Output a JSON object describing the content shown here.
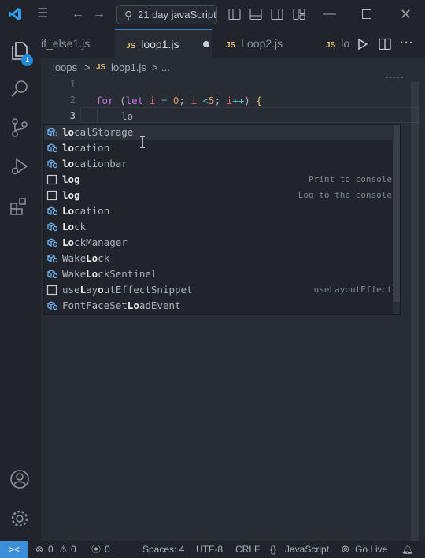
{
  "title_bar": {
    "search_text": "21 day javaScript"
  },
  "activity_bar": {
    "explorer_badge": "1"
  },
  "tabs": [
    {
      "label": "if_else1.js",
      "lang": ""
    },
    {
      "label": "loop1.js",
      "lang": "JS",
      "active": true,
      "modified": true
    },
    {
      "label": "Loop2.js",
      "lang": "JS"
    },
    {
      "label": "lo",
      "lang": "JS"
    }
  ],
  "breadcrumb": {
    "folder": "loops",
    "sep1": ">",
    "file_lang": "JS",
    "file": "loop1.js",
    "sep2": ">",
    "more": "..."
  },
  "editor": {
    "line_numbers": [
      "1",
      "2",
      "3"
    ],
    "line2": {
      "for": "for",
      "paren_open": " (",
      "let": "let",
      "i1": " i ",
      "eq": "=",
      "zero": " 0",
      "semi1": "; ",
      "i2": "i ",
      "lt": "<",
      "five": "5",
      "semi2": "; ",
      "i3": "i",
      "inc": "++",
      "close": ")",
      "brace": " {"
    },
    "line3_text": "lo"
  },
  "suggestions": [
    {
      "pre": "lo",
      "post": "calStorage",
      "kind": "property",
      "detail": ""
    },
    {
      "pre": "lo",
      "post": "cation",
      "kind": "property",
      "detail": ""
    },
    {
      "pre": "lo",
      "post": "cationbar",
      "kind": "property",
      "detail": ""
    },
    {
      "pre": "log",
      "post": "",
      "kind": "snippet",
      "detail": "Print to console"
    },
    {
      "pre": "log",
      "post": "",
      "kind": "snippet",
      "detail": "Log to the console"
    },
    {
      "pre": "Lo",
      "post": "cation",
      "kind": "property",
      "detail": ""
    },
    {
      "pre": "Lo",
      "post": "ck",
      "kind": "property",
      "detail": ""
    },
    {
      "pre": "Lo",
      "post": "ckManager",
      "kind": "property",
      "detail": ""
    },
    {
      "pre_plain": "Wake",
      "pre": "Lo",
      "post": "ck",
      "kind": "property",
      "detail": ""
    },
    {
      "pre_plain": "Wake",
      "pre": "Lo",
      "post": "ckSentinel",
      "kind": "property",
      "detail": ""
    },
    {
      "pre_plain": "use",
      "pre": "L",
      "mid": "ay",
      "pre2": "o",
      "post": "utEffectSnippet",
      "kind": "snippet",
      "detail": "useLayoutEffect"
    },
    {
      "pre_plain": "FontFaceSet",
      "pre": "Lo",
      "post": "adEvent",
      "kind": "property",
      "detail": ""
    }
  ],
  "status_bar": {
    "remote": "><",
    "errors": "0",
    "warnings": "0",
    "ports": "0",
    "spaces": "Spaces: 4",
    "encoding": "UTF-8",
    "eol": "CRLF",
    "language": "JavaScript",
    "go_live": "Go Live"
  },
  "colors": {
    "accent": "#3a8fd8",
    "keyword": "#c678dd",
    "number": "#d19a66"
  }
}
